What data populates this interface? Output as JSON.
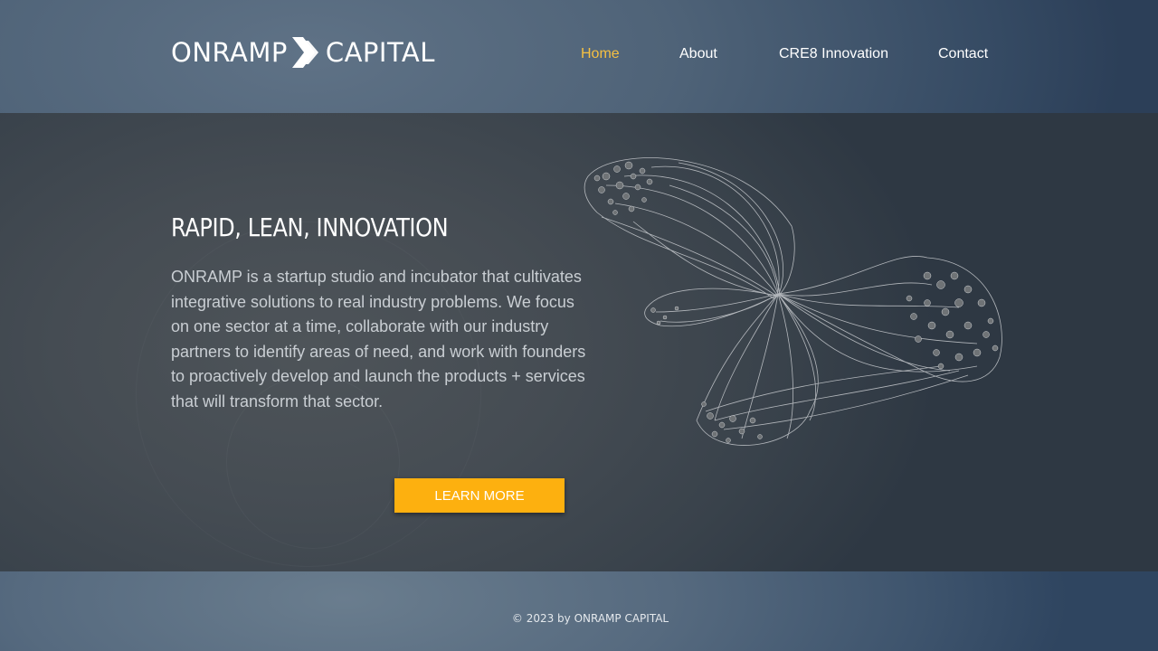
{
  "header": {
    "logo_left": "ONRAMP",
    "logo_right": "CAPITAL",
    "logo_icon": "double-chevron-right-icon"
  },
  "nav": {
    "items": [
      {
        "label": "Home",
        "active": true
      },
      {
        "label": "About",
        "active": false
      },
      {
        "label": "CRE8 Innovation",
        "active": false
      },
      {
        "label": "Contact",
        "active": false
      }
    ],
    "active_color": "#f5c042"
  },
  "hero": {
    "title": "RAPID, LEAN, INNOVATION",
    "body": "ONRAMP is a startup studio and incubator that cultivates integrative solutions to real industry problems. We focus on one sector at a time, collaborate with our industry partners to identify areas of need, and work with founders to proactively develop and launch the products + services that will transform that sector.",
    "button_label": "LEARN MORE",
    "button_color": "#fdb00f",
    "image": "network-graph-illustration"
  },
  "footer": {
    "copyright": "© 2023 by ONRAMP CAPITAL"
  }
}
